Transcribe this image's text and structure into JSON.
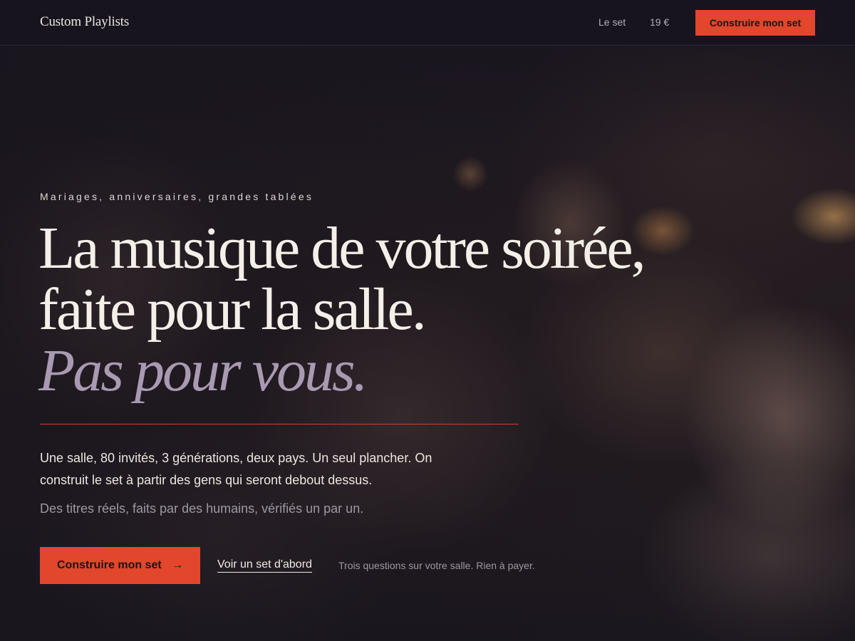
{
  "header": {
    "brand": "Custom Playlists",
    "nav": [
      {
        "label": "Le set"
      },
      {
        "label": "19 €"
      }
    ],
    "cta_label": "Construire mon set"
  },
  "hero": {
    "eyebrow": "Mariages, anniversaires, grandes tablées",
    "headline": {
      "line1": "La musique de votre soirée,",
      "line2": "faite pour la salle.",
      "line3": "Pas pour vous."
    },
    "lede": "Une salle, 80 invités, 3 générations, deux pays. Un seul plancher. On construit le set à partir des gens qui seront debout dessus.",
    "sub": "Des titres réels, faits par des humains, vérifiés un par un.",
    "primary_cta": "Construire mon set",
    "primary_cta_arrow": "→",
    "secondary_cta": "Voir un set d'abord",
    "note": "Trois questions sur votre salle. Rien à payer."
  },
  "colors": {
    "background": "#17141d",
    "accent": "#e2462c",
    "headline": "#f4efe8",
    "headline_accent": "#a89ab3",
    "muted": "#9d97a3"
  }
}
